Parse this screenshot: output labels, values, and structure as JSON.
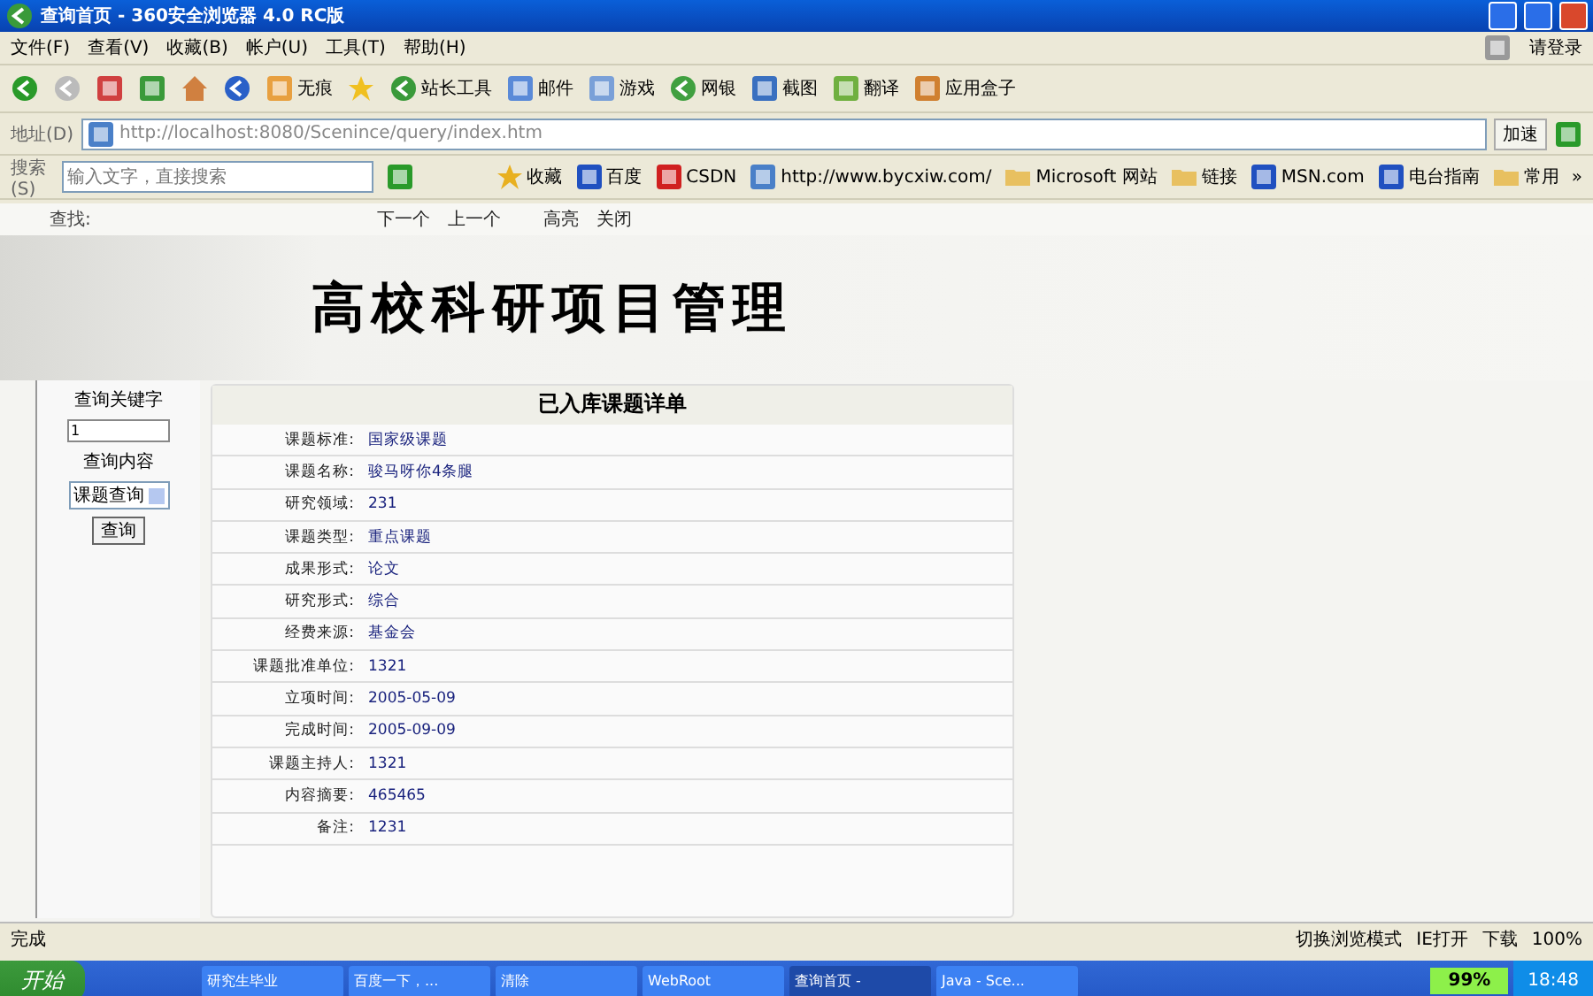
{
  "window": {
    "title": "查询首页 - 360安全浏览器 4.0 RC版"
  },
  "menu": [
    "文件(F)",
    "查看(V)",
    "收藏(B)",
    "帐户(U)",
    "工具(T)",
    "帮助(H)"
  ],
  "login": "请登录",
  "toolbar": [
    {
      "label": "无痕"
    },
    {
      "label": "站长工具"
    },
    {
      "label": "邮件"
    },
    {
      "label": "游戏"
    },
    {
      "label": "网银"
    },
    {
      "label": "截图"
    },
    {
      "label": "翻译"
    },
    {
      "label": "应用盒子"
    }
  ],
  "address": {
    "label": "地址(D)",
    "value": "http://localhost:8080/Scenince/query/index.htm",
    "go": "加速"
  },
  "search": {
    "label": "搜索(S)",
    "placeholder": "输入文字，直接搜索"
  },
  "bookmarks": [
    "收藏",
    "百度",
    "CSDN",
    "http://www.bycxiw.com/",
    "Microsoft 网站",
    "链接",
    "MSN.com",
    "电台指南",
    "常用",
    "»"
  ],
  "find_bar": {
    "label": "查找:",
    "buttons": [
      "下一个",
      "上一个",
      "高亮",
      "关闭"
    ]
  },
  "banner": {
    "title": "高校科研项目管理"
  },
  "sidebar": {
    "keyword_label": "查询关键字",
    "keyword_value": "1",
    "content_label": "查询内容",
    "select_value": "课题查询",
    "button": "查询"
  },
  "detail": {
    "title": "已入库课题详单",
    "rows": [
      {
        "label": "课题标准:",
        "value": "国家级课题"
      },
      {
        "label": "课题名称:",
        "value": "骏马呀你4条腿"
      },
      {
        "label": "研究领域:",
        "value": "231"
      },
      {
        "label": "课题类型:",
        "value": "重点课题"
      },
      {
        "label": "成果形式:",
        "value": "论文"
      },
      {
        "label": "研究形式:",
        "value": "综合"
      },
      {
        "label": "经费来源:",
        "value": "基金会"
      },
      {
        "label": "课题批准单位:",
        "value": "1321"
      },
      {
        "label": "立项时间:",
        "value": "2005-05-09"
      },
      {
        "label": "完成时间:",
        "value": "2005-09-09"
      },
      {
        "label": "课题主持人:",
        "value": "1321"
      },
      {
        "label": "内容摘要:",
        "value": "465465"
      },
      {
        "label": "备注:",
        "value": "1231"
      }
    ]
  },
  "status_bar": {
    "text": "完成",
    "items": [
      "切换浏览模式",
      "IE打开",
      "下载",
      "100%"
    ]
  },
  "taskbar": {
    "start": "开始",
    "tasks": [
      {
        "label": "研究生毕业",
        "selected": false
      },
      {
        "label": "百度一下，...",
        "selected": false
      },
      {
        "label": "清除",
        "selected": false
      },
      {
        "label": "WebRoot",
        "selected": false
      },
      {
        "label": "查询首页 -",
        "selected": true
      },
      {
        "label": "Java - Sce...",
        "selected": false
      }
    ],
    "meter": "99%",
    "clock": "18:48"
  }
}
